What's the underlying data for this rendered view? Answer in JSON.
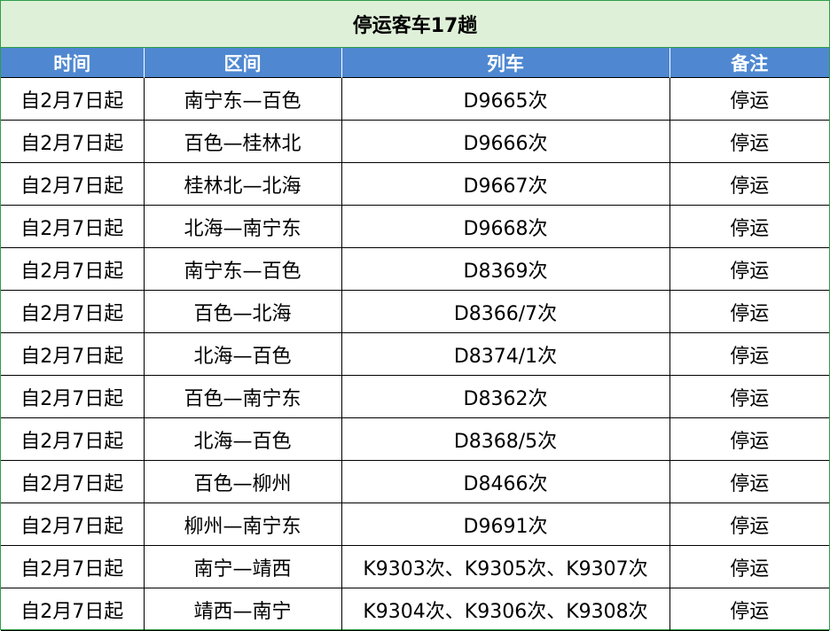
{
  "title": "停运客车17趟",
  "colors": {
    "title_background": "#dff0d8",
    "header_background": "#4f88d1",
    "header_text": "#ffffff",
    "border_green": "#2e9e4a"
  },
  "columns": [
    "时间",
    "区间",
    "列车",
    "备注"
  ],
  "rows": [
    {
      "time": "自2月7日起",
      "section": "南宁东—百色",
      "train": "D9665次",
      "note": "停运"
    },
    {
      "time": "自2月7日起",
      "section": "百色—桂林北",
      "train": "D9666次",
      "note": "停运"
    },
    {
      "time": "自2月7日起",
      "section": "桂林北—北海",
      "train": "D9667次",
      "note": "停运"
    },
    {
      "time": "自2月7日起",
      "section": "北海—南宁东",
      "train": "D9668次",
      "note": "停运"
    },
    {
      "time": "自2月7日起",
      "section": "南宁东—百色",
      "train": "D8369次",
      "note": "停运"
    },
    {
      "time": "自2月7日起",
      "section": "百色—北海",
      "train": "D8366/7次",
      "note": "停运"
    },
    {
      "time": "自2月7日起",
      "section": "北海—百色",
      "train": "D8374/1次",
      "note": "停运"
    },
    {
      "time": "自2月7日起",
      "section": "百色—南宁东",
      "train": "D8362次",
      "note": "停运"
    },
    {
      "time": "自2月7日起",
      "section": "北海—百色",
      "train": "D8368/5次",
      "note": "停运"
    },
    {
      "time": "自2月7日起",
      "section": "百色—柳州",
      "train": "D8466次",
      "note": "停运"
    },
    {
      "time": "自2月7日起",
      "section": "柳州—南宁东",
      "train": "D9691次",
      "note": "停运"
    },
    {
      "time": "自2月7日起",
      "section": "南宁—靖西",
      "train": "K9303次、K9305次、K9307次",
      "note": "停运"
    },
    {
      "time": "自2月7日起",
      "section": "靖西—南宁",
      "train": "K9304次、K9306次、K9308次",
      "note": "停运"
    }
  ]
}
